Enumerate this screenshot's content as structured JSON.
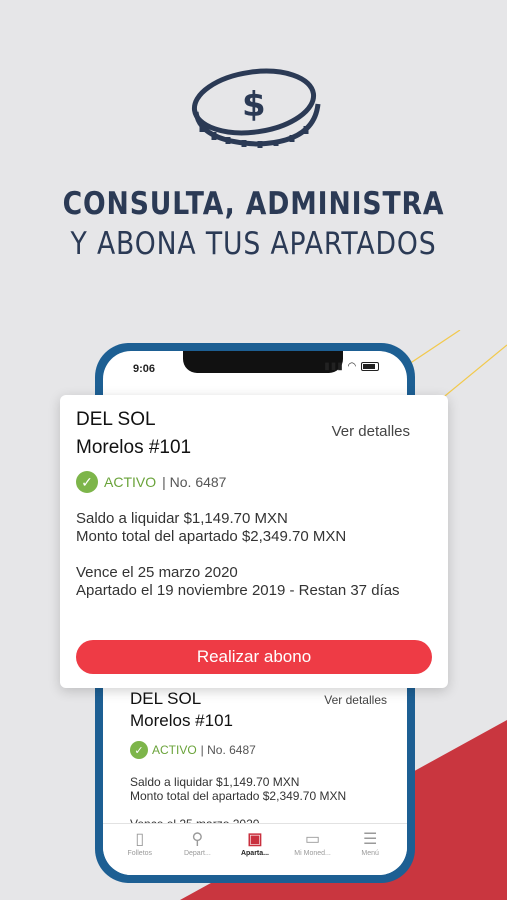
{
  "colors": {
    "accent": "#ee3b45",
    "brand_blue": "#2b3a55",
    "active_green": "#7db54a",
    "bg_red": "#c9363f"
  },
  "headline": {
    "line1": "CONSULTA, ADMINISTRA",
    "line2": "Y ABONA TUS APARTADOS"
  },
  "phone": {
    "time": "9:06",
    "bg_card": {
      "store": "DEL SOL",
      "branch": "Morelos #101",
      "details_link": "Ver detalles",
      "status": "ACTIVO",
      "number": "| No. 6487",
      "saldo": "Saldo a liquidar $1,149.70 MXN",
      "monto": "Monto total del apartado $2,349.70 MXN",
      "vence": "Vence el 25 marzo 2020"
    },
    "tabs": [
      {
        "label": "Folletos",
        "icon": "folder-icon"
      },
      {
        "label": "Depart...",
        "icon": "search-icon"
      },
      {
        "label": "Aparta...",
        "icon": "layaway-icon"
      },
      {
        "label": "Mi Moned...",
        "icon": "wallet-card-icon"
      },
      {
        "label": "Menú",
        "icon": "menu-icon"
      }
    ]
  },
  "card": {
    "store": "DEL SOL",
    "branch": "Morelos #101",
    "details_link": "Ver detalles",
    "status": "ACTIVO",
    "number": "| No. 6487",
    "saldo": "Saldo a liquidar $1,149.70 MXN",
    "monto": "Monto total del apartado $2,349.70 MXN",
    "vence": "Vence el 25 marzo 2020",
    "apartado": "Apartado el 19 noviembre 2019 - Restan 37 días",
    "button": "Realizar abono"
  }
}
